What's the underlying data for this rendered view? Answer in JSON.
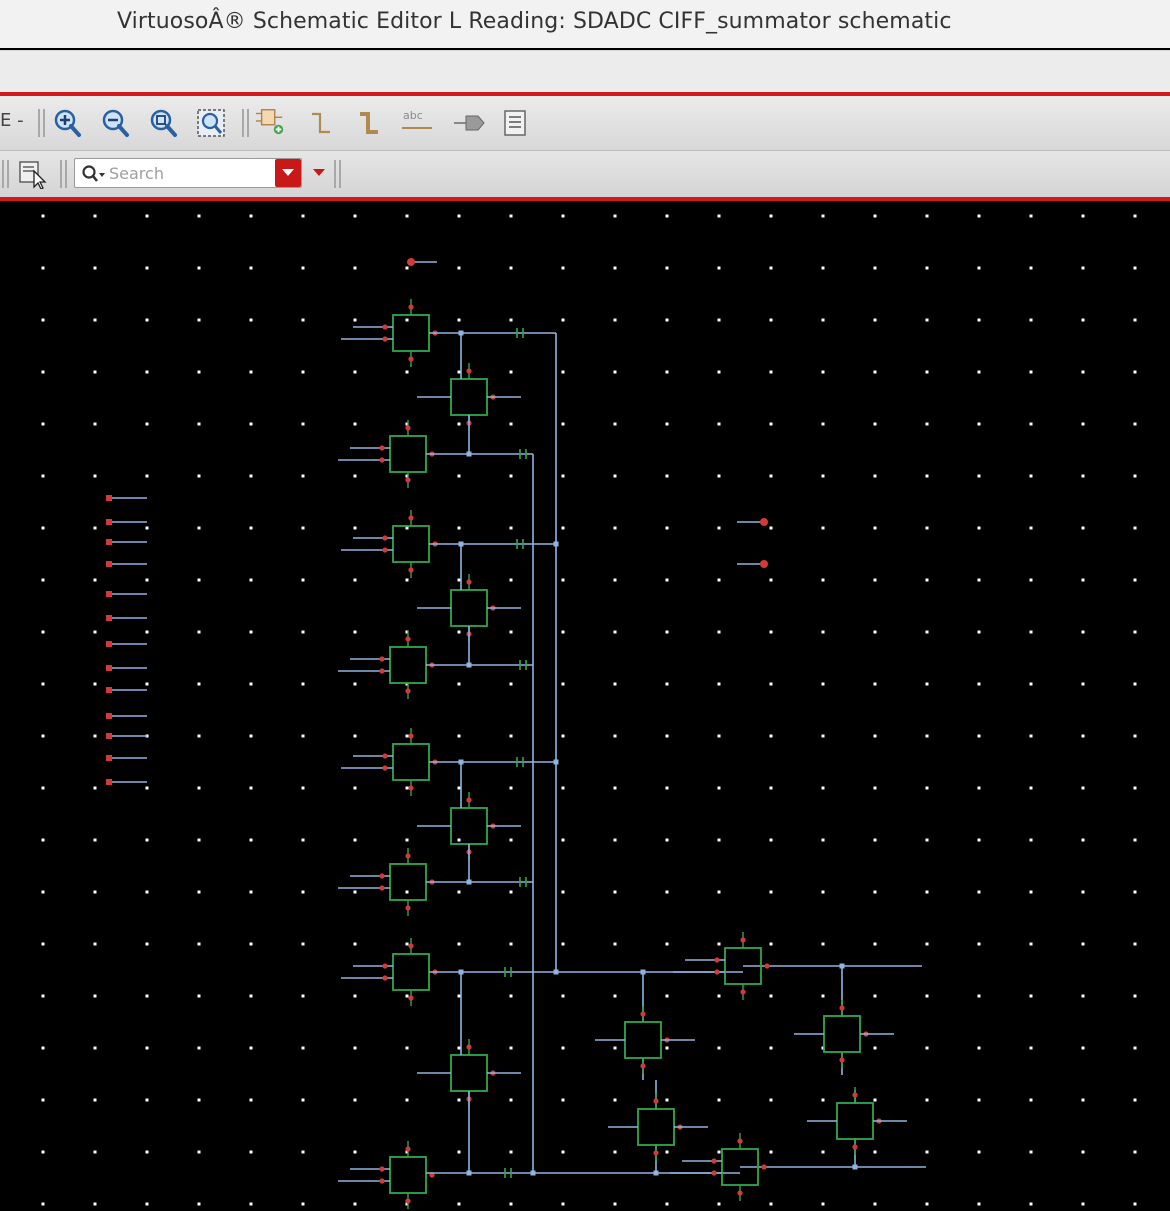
{
  "window": {
    "title": "VirtuosoÂ® Schematic Editor L Reading: SDADC CIFF_summator schematic"
  },
  "toolbar": {
    "icons": [
      "zoom-in-icon",
      "zoom-out-icon",
      "zoom-fit-icon",
      "zoom-area-icon",
      "create-instance-icon",
      "create-wire-icon",
      "create-wide-wire-icon",
      "create-label-icon",
      "create-pin-icon",
      "property-editor-icon"
    ]
  },
  "search": {
    "placeholder": "Search"
  },
  "colors": {
    "canvas": "#000000",
    "grid_dot": "#ffffff",
    "wire": "#8fb4e0",
    "instance": "#2fa84f",
    "pin": "#d23a3a",
    "accent": "#d21a1a"
  }
}
